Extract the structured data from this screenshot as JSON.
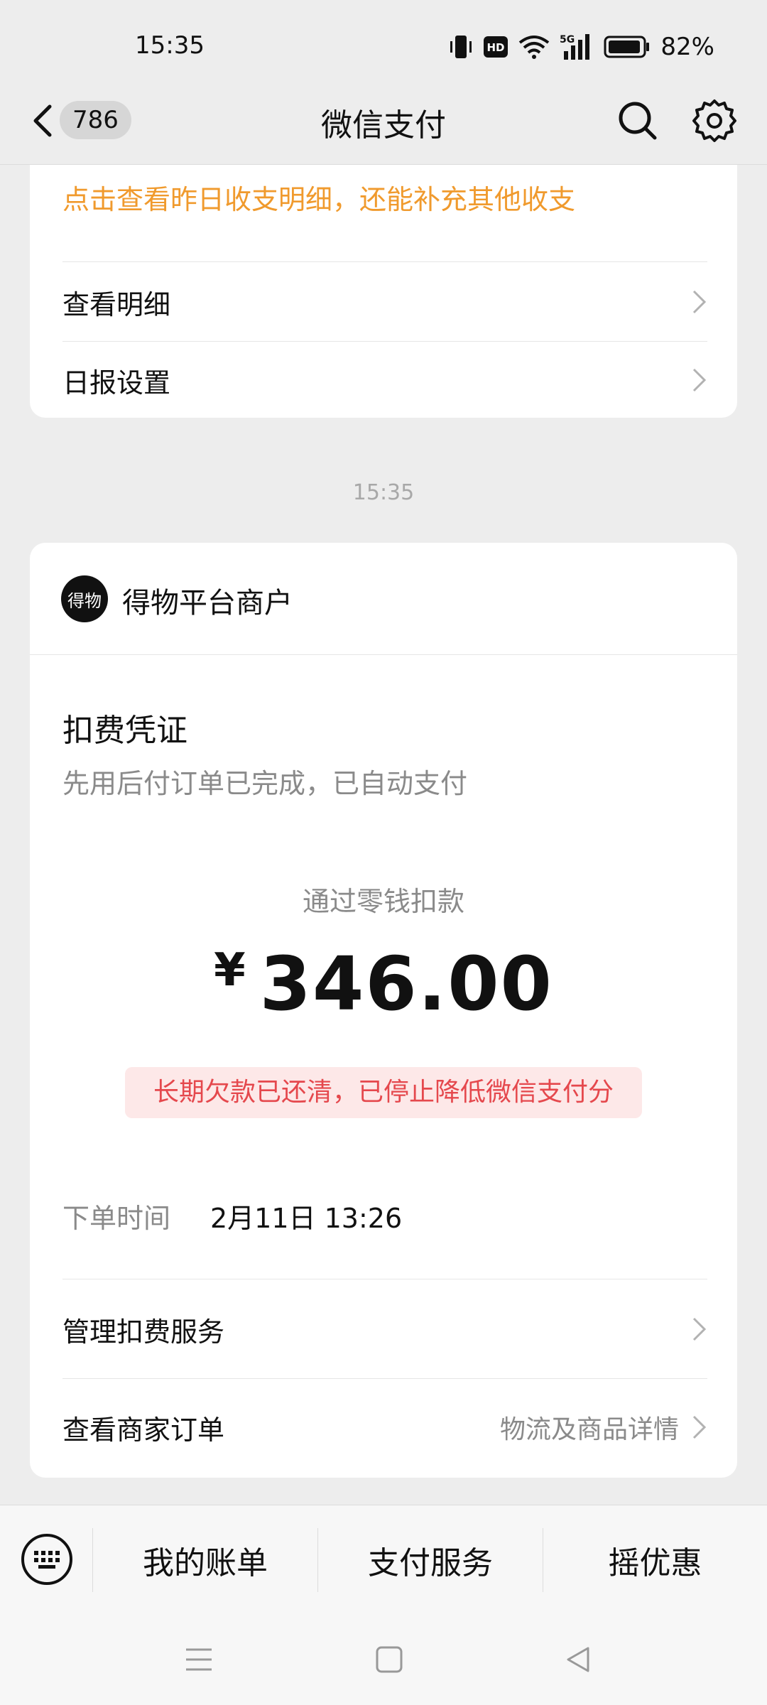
{
  "status_bar": {
    "time": "15:35",
    "battery_percent": "82%",
    "hd_badge": "HD",
    "network": "5G",
    "icons": [
      "vibrate-icon",
      "hd-icon",
      "wifi-icon",
      "signal-5g-icon",
      "battery-icon"
    ]
  },
  "nav": {
    "title": "微信支付",
    "unread_count": "786"
  },
  "daily_report_card": {
    "hint": "点击查看昨日收支明细，还能补充其他收支",
    "items": [
      {
        "label": "查看明细"
      },
      {
        "label": "日报设置"
      }
    ]
  },
  "message_time": "15:35",
  "receipt_card": {
    "merchant_logo_text": "得物",
    "merchant_name": "得物平台商户",
    "title": "扣费凭证",
    "subtitle": "先用后付订单已完成，已自动支付",
    "pay_method": "通过零钱扣款",
    "currency_symbol": "¥",
    "amount": "346.00",
    "notice": "长期欠款已还清，已停止降低微信支付分",
    "order_time_label": "下单时间",
    "order_time_value": "2月11日 13:26",
    "links": [
      {
        "label": "管理扣费服务",
        "note": ""
      },
      {
        "label": "查看商家订单",
        "note": "物流及商品详情"
      }
    ]
  },
  "bottom_menu": {
    "items": [
      "我的账单",
      "支付服务",
      "摇优惠"
    ]
  },
  "colors": {
    "background": "#ededed",
    "hint_orange": "#f09a2d",
    "notice_red": "#e5484d",
    "notice_bg": "#fde8e8",
    "muted_text": "#8a8a8a"
  }
}
